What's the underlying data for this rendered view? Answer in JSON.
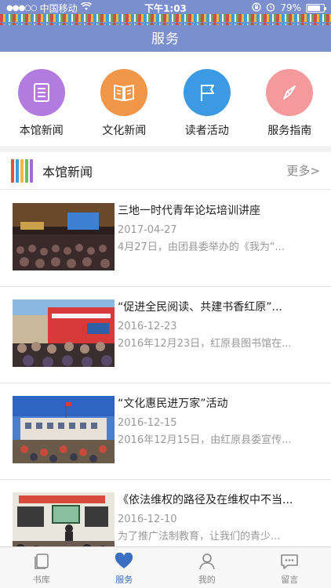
{
  "status_bar": {
    "carrier": "中国移动",
    "time": "下午1:03",
    "battery": "79%",
    "battery_level": 0.79
  },
  "header": {
    "title": "服务"
  },
  "categories": [
    {
      "label": "本馆新闻",
      "color": "#b37be0",
      "icon": "news-list-icon"
    },
    {
      "label": "文化新闻",
      "color": "#f0974a",
      "icon": "open-book-icon"
    },
    {
      "label": "读者活动",
      "color": "#3b9ae2",
      "icon": "flag-icon"
    },
    {
      "label": "服务指南",
      "color": "#f49a9c",
      "icon": "compass-icon"
    }
  ],
  "section": {
    "title": "本馆新闻",
    "more": "更多>"
  },
  "news": [
    {
      "title": "三地一时代青年论坛培训讲座",
      "date": "2017-04-27",
      "summary": "4月27日，由团县委举办的《我为“..."
    },
    {
      "title": "“促进全民阅读、共建书香红原”...",
      "date": "2016-12-23",
      "summary": "2016年12月23日，红原县图书馆在..."
    },
    {
      "title": "“文化惠民进万家”活动",
      "date": "2016-12-15",
      "summary": "2016年12月15日，由红原县委宣传..."
    },
    {
      "title": "《依法维权的路径及在维权中不当...",
      "date": "2016-12-10",
      "summary": "为了推广法制教育，让我们的青少..."
    }
  ],
  "tabbar": [
    {
      "label": "书库",
      "icon": "book-icon",
      "active": false
    },
    {
      "label": "服务",
      "icon": "heart-icon",
      "active": true
    },
    {
      "label": "我的",
      "icon": "person-icon",
      "active": false
    },
    {
      "label": "留言",
      "icon": "message-icon",
      "active": false
    }
  ],
  "colors": {
    "header": "#7b8fce",
    "accent": "#3b6fc1"
  }
}
